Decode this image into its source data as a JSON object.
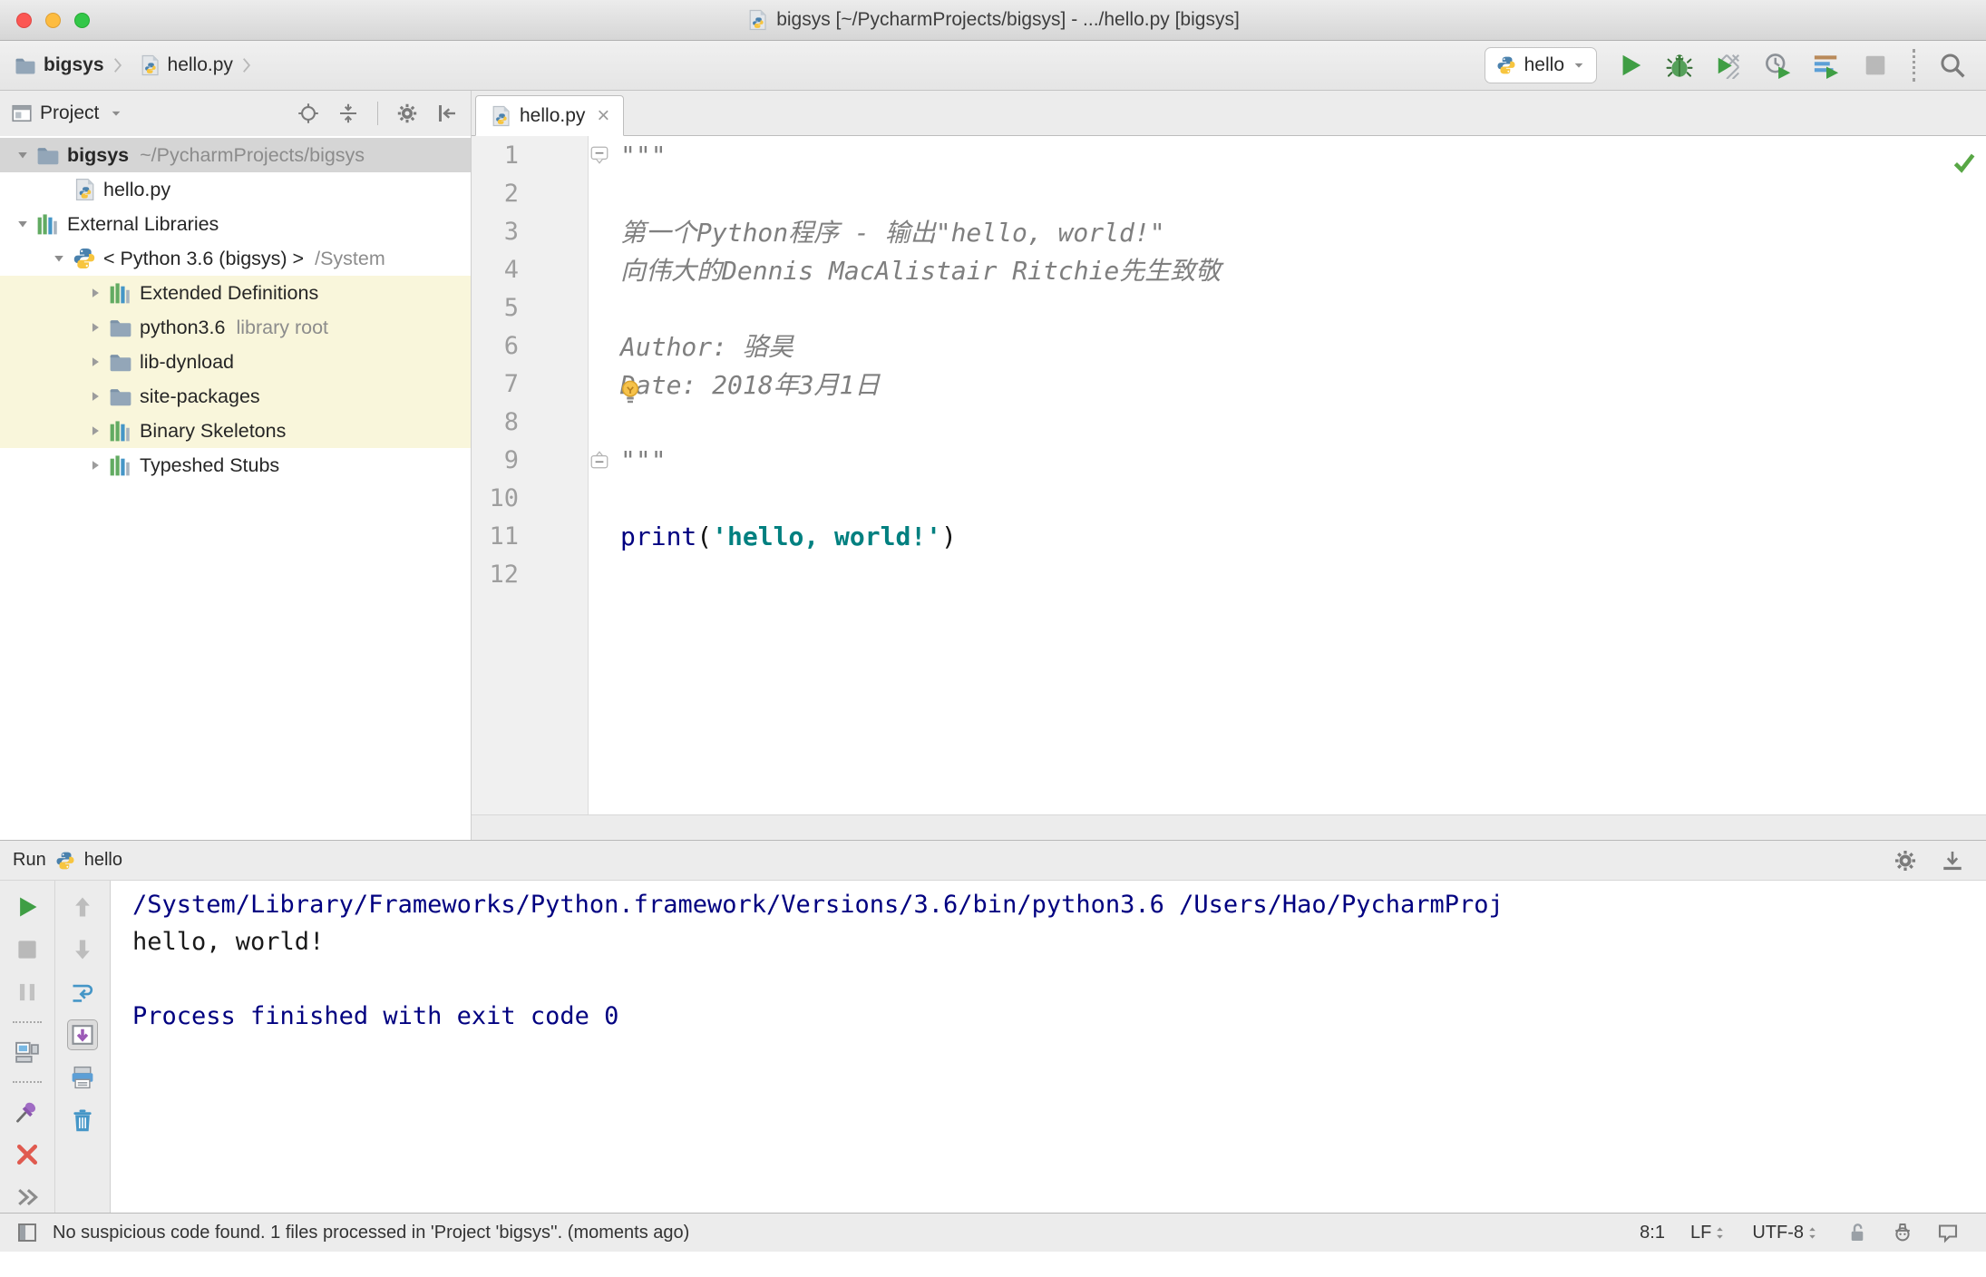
{
  "window": {
    "title": "bigsys [~/PycharmProjects/bigsys] - .../hello.py [bigsys]"
  },
  "toolbar": {
    "breadcrumbs": [
      {
        "icon": "folder",
        "label": "bigsys",
        "bold": true
      },
      {
        "icon": "python-file",
        "label": "hello.py",
        "bold": false
      }
    ],
    "run_config": {
      "icon": "python",
      "label": "hello"
    },
    "actions": [
      "run",
      "debug",
      "run-with-coverage",
      "profiler",
      "concurrency-diagram",
      "stop",
      "separator",
      "search-everywhere"
    ]
  },
  "project_panel": {
    "title": "Project",
    "header_actions": [
      "locate",
      "collapse-all",
      "separator",
      "settings",
      "hide"
    ],
    "tree": [
      {
        "label": "bigsys",
        "hint": "~/PycharmProjects/bigsys",
        "icon": "folder",
        "arrow": "open",
        "level": 0,
        "selected": true,
        "bold": true
      },
      {
        "label": "hello.py",
        "icon": "python-file",
        "arrow": "none",
        "level": 1
      },
      {
        "label": "External Libraries",
        "icon": "library",
        "arrow": "open",
        "level": 0
      },
      {
        "label": "< Python 3.6 (bigsys) >",
        "hint": "/System",
        "icon": "python",
        "arrow": "open",
        "level": 1
      },
      {
        "label": "Extended Definitions",
        "icon": "library",
        "arrow": "closed",
        "level": 2,
        "highlight": true
      },
      {
        "label": "python3.6",
        "hint": "library root",
        "icon": "folder",
        "arrow": "closed",
        "level": 2,
        "highlight": true
      },
      {
        "label": "lib-dynload",
        "icon": "folder",
        "arrow": "closed",
        "level": 2,
        "highlight": true
      },
      {
        "label": "site-packages",
        "icon": "folder",
        "arrow": "closed",
        "level": 2,
        "highlight": true
      },
      {
        "label": "Binary Skeletons",
        "icon": "library",
        "arrow": "closed",
        "level": 2,
        "highlight": true
      },
      {
        "label": "Typeshed Stubs",
        "icon": "library",
        "arrow": "closed",
        "level": 2,
        "highlight": false
      }
    ]
  },
  "editor": {
    "tab": {
      "icon": "python-file",
      "label": "hello.py",
      "close": "×"
    },
    "inspection_status": "ok",
    "lines": [
      {
        "n": "1",
        "fold": "start",
        "segs": [
          {
            "t": "\"\"\"",
            "s": "doc"
          }
        ]
      },
      {
        "n": "2",
        "segs": []
      },
      {
        "n": "3",
        "segs": [
          {
            "t": "第一个Python程序 - 输出\"hello, world!\"",
            "s": "doc"
          }
        ]
      },
      {
        "n": "4",
        "segs": [
          {
            "t": "向伟大的Dennis MacAlistair Ritchie先生致敬",
            "s": "doc"
          }
        ]
      },
      {
        "n": "5",
        "segs": []
      },
      {
        "n": "6",
        "segs": [
          {
            "t": "Author: 骆昊",
            "s": "doc"
          }
        ]
      },
      {
        "n": "7",
        "bulb": true,
        "segs": [
          {
            "t": "Date: 2018年3月1日",
            "s": "doc"
          }
        ]
      },
      {
        "n": "8",
        "current": true,
        "segs": []
      },
      {
        "n": "9",
        "fold": "end",
        "segs": [
          {
            "t": "\"\"\"",
            "s": "doc"
          }
        ]
      },
      {
        "n": "10",
        "segs": []
      },
      {
        "n": "11",
        "segs": [
          {
            "t": "print",
            "s": "kw"
          },
          {
            "t": "(",
            "s": "pl"
          },
          {
            "t": "'hello, world!'",
            "s": "str"
          },
          {
            "t": ")",
            "s": "pl"
          }
        ]
      },
      {
        "n": "12",
        "segs": []
      }
    ]
  },
  "run_panel": {
    "title": "Run",
    "config": {
      "icon": "python",
      "label": "hello"
    },
    "header_actions": [
      "settings",
      "hide-down"
    ],
    "toolbar_left": [
      "rerun",
      "stop",
      "pause",
      "separator",
      "restore-layout",
      "separator",
      "pin",
      "close",
      "more"
    ],
    "toolbar_right": [
      "up",
      "down",
      "soft-wrap",
      "scroll-to-end",
      "print",
      "clear"
    ],
    "console": [
      {
        "t": "/System/Library/Frameworks/Python.framework/Versions/3.6/bin/python3.6 /Users/Hao/PycharmProj",
        "s": "system"
      },
      {
        "t": "hello, world!",
        "s": "stdout"
      },
      {
        "t": "",
        "s": "stdout"
      },
      {
        "t": "Process finished with exit code 0",
        "s": "system"
      }
    ]
  },
  "statusbar": {
    "message": "No suspicious code found. 1 files processed in 'Project 'bigsys''. (moments ago)",
    "caret_position": "8:1",
    "line_separator": "LF",
    "encoding": "UTF-8",
    "icons": [
      "unlock",
      "hector",
      "feedback-bubble"
    ]
  },
  "colors": {
    "run_green": "#3f9e44",
    "keyword": "#000080",
    "string": "#008080",
    "docstring": "#7f7f7f",
    "console_system": "#000080",
    "current_line": "#fcf6da",
    "tree_highlight": "#f9f6db",
    "selection_gray": "#d5d5d5"
  }
}
